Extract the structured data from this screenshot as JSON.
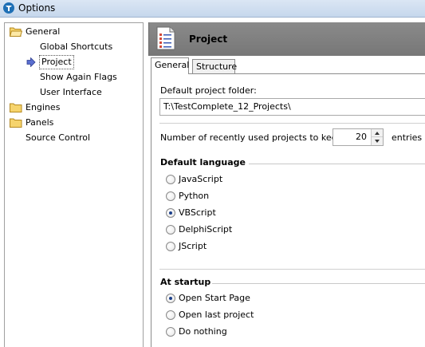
{
  "window": {
    "title": "Options"
  },
  "tree": {
    "items": [
      {
        "label": "General",
        "icon": "folder-open-icon"
      },
      {
        "label": "Global Shortcuts"
      },
      {
        "label": "Project",
        "selected": true
      },
      {
        "label": "Show Again Flags"
      },
      {
        "label": "User Interface"
      },
      {
        "label": "Engines",
        "icon": "folder-icon"
      },
      {
        "label": "Panels",
        "icon": "folder-icon"
      },
      {
        "label": "Source Control"
      }
    ]
  },
  "page": {
    "title": "Project",
    "tabs": [
      {
        "label": "General",
        "active": true
      },
      {
        "label": "Structure"
      }
    ],
    "default_folder": {
      "label": "Default project folder:",
      "value": "T:\\TestComplete_12_Projects\\"
    },
    "recent": {
      "label": "Number of recently used projects to keep:",
      "value": "20",
      "unit": "entries"
    },
    "default_language": {
      "title": "Default language",
      "options": [
        "JavaScript",
        "Python",
        "VBScript",
        "DelphiScript",
        "JScript"
      ],
      "selected": "VBScript"
    },
    "at_startup": {
      "title": "At startup",
      "options": [
        "Open Start Page",
        "Open last project",
        "Do nothing"
      ],
      "selected": "Open Start Page"
    }
  },
  "colors": {
    "header_bg": "#808080",
    "titlebar_bg": "#c6d7ec",
    "accent": "#1b3f8a"
  }
}
